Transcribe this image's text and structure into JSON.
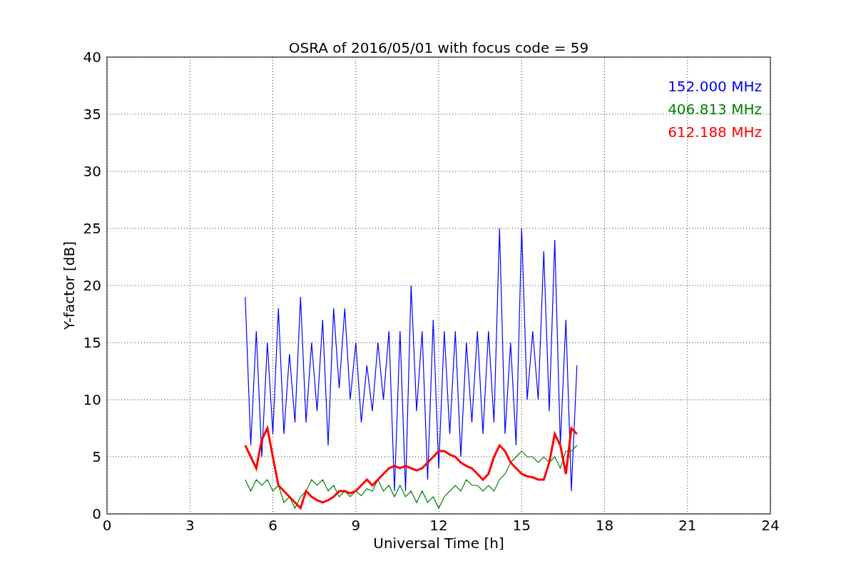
{
  "chart_data": {
    "type": "line",
    "title": "OSRA of 2016/05/01 with focus code = 59",
    "xlabel": "Universal Time [h]",
    "ylabel": "Y-factor [dB]",
    "grid": true,
    "xlim": [
      0,
      24
    ],
    "ylim": [
      0,
      40
    ],
    "xticks": [
      0,
      3,
      6,
      9,
      12,
      15,
      18,
      21,
      24
    ],
    "yticks": [
      0,
      5,
      10,
      15,
      20,
      25,
      30,
      35,
      40
    ],
    "x": [
      5.0,
      5.2,
      5.4,
      5.6,
      5.8,
      6.0,
      6.2,
      6.4,
      6.6,
      6.8,
      7.0,
      7.2,
      7.4,
      7.6,
      7.8,
      8.0,
      8.2,
      8.4,
      8.6,
      8.8,
      9.0,
      9.2,
      9.4,
      9.6,
      9.8,
      10.0,
      10.2,
      10.4,
      10.6,
      10.8,
      11.0,
      11.2,
      11.4,
      11.6,
      11.8,
      12.0,
      12.2,
      12.4,
      12.6,
      12.8,
      13.0,
      13.2,
      13.4,
      13.6,
      13.8,
      14.0,
      14.2,
      14.4,
      14.6,
      14.8,
      15.0,
      15.2,
      15.4,
      15.6,
      15.8,
      16.0,
      16.2,
      16.4,
      16.6,
      16.8,
      17.0
    ],
    "series": [
      {
        "name": "152.000 MHz",
        "color": "#0000ff",
        "values": [
          19,
          6,
          16,
          5,
          15,
          7,
          18,
          7,
          14,
          8,
          19,
          8,
          15,
          9,
          17,
          6,
          18,
          11,
          18,
          10,
          15,
          8,
          13,
          9,
          15,
          10,
          16,
          2,
          16,
          2,
          20,
          9,
          16,
          3,
          17,
          4,
          16,
          7,
          16,
          5,
          15,
          8,
          16,
          7,
          16,
          8,
          25,
          7,
          15,
          6,
          25,
          10,
          16,
          10,
          23,
          9,
          24,
          6,
          17,
          2,
          13
        ]
      },
      {
        "name": "406.813 MHz",
        "color": "#008000",
        "values": [
          3,
          2,
          3,
          2.5,
          3,
          2,
          2.5,
          1,
          1.5,
          0.5,
          1.5,
          2,
          3,
          2.5,
          3,
          2,
          2.5,
          1.5,
          2,
          1.5,
          2,
          1.6,
          2.2,
          2,
          3,
          2,
          2.5,
          1.5,
          2.5,
          1.5,
          2,
          1,
          2,
          1,
          1.5,
          0.5,
          1.5,
          2,
          2.5,
          2,
          3,
          2.5,
          2.5,
          2,
          2.5,
          2,
          3,
          3.5,
          4.5,
          5,
          5.5,
          5,
          5,
          4.5,
          5,
          4.5,
          5,
          4,
          5.5,
          5.5,
          6
        ]
      },
      {
        "name": "612.188 MHz",
        "color": "#ff0000",
        "values": [
          6,
          5,
          4,
          6.5,
          7.5,
          5,
          2.5,
          2,
          1.5,
          1,
          0.5,
          2,
          1.5,
          1.2,
          1,
          1.2,
          1.5,
          2,
          2,
          1.8,
          2,
          2.5,
          3,
          2.5,
          3,
          3.5,
          4,
          4.2,
          4,
          4.2,
          4,
          3.8,
          4,
          4.5,
          5,
          5.5,
          5.5,
          5.2,
          5,
          4.5,
          4.2,
          4,
          3.5,
          3,
          3.5,
          5,
          6,
          5.5,
          4.5,
          4,
          3.5,
          3.3,
          3.2,
          3,
          3,
          4.5,
          7,
          6,
          3.5,
          7.5,
          7
        ]
      }
    ]
  }
}
